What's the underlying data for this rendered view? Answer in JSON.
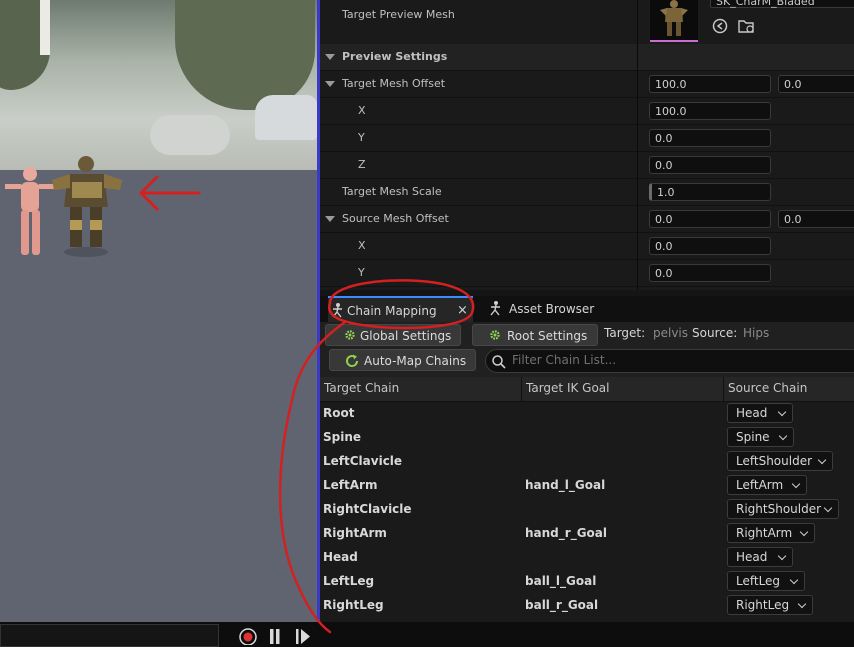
{
  "details": {
    "target_preview_mesh_label": "Target Preview Mesh",
    "mesh_name": "SK_CharM_Bladed",
    "preview_settings_label": "Preview Settings",
    "target_mesh_offset_label": "Target Mesh Offset",
    "target_mesh_offset_value": "100.0",
    "target_mesh_offset_value2": "0.0",
    "x_label": "X",
    "x_value": "100.0",
    "y_label": "Y",
    "y_value": "0.0",
    "z_label": "Z",
    "z_value": "0.0",
    "target_mesh_scale_label": "Target Mesh Scale",
    "target_mesh_scale_value": "1.0",
    "source_mesh_offset_label": "Source Mesh Offset",
    "source_mesh_offset_value": "0.0",
    "source_mesh_offset_value2": "0.0",
    "src_x_label": "X",
    "src_x_value": "0.0",
    "src_y_label": "Y",
    "src_y_value": "0.0"
  },
  "tabs": {
    "chain_mapping": "Chain Mapping",
    "close": "×",
    "asset_browser": "Asset Browser"
  },
  "toolbar": {
    "global_settings": "Global Settings",
    "root_settings": "Root Settings",
    "target_label": "Target:",
    "target_value": "pelvis",
    "source_label": "Source:",
    "source_value": "Hips",
    "auto_map": "Auto-Map Chains",
    "filter_placeholder": "Filter Chain List..."
  },
  "table": {
    "headers": [
      "Target Chain",
      "Target IK Goal",
      "Source Chain"
    ],
    "rows": [
      {
        "target": "Root",
        "goal": "",
        "source": "Head"
      },
      {
        "target": "Spine",
        "goal": "",
        "source": "Spine"
      },
      {
        "target": "LeftClavicle",
        "goal": "",
        "source": "LeftShoulder"
      },
      {
        "target": "LeftArm",
        "goal": "hand_l_Goal",
        "source": "LeftArm"
      },
      {
        "target": "RightClavicle",
        "goal": "",
        "source": "RightShoulder"
      },
      {
        "target": "RightArm",
        "goal": "hand_r_Goal",
        "source": "RightArm"
      },
      {
        "target": "Head",
        "goal": "",
        "source": "Head"
      },
      {
        "target": "LeftLeg",
        "goal": "ball_l_Goal",
        "source": "LeftLeg"
      },
      {
        "target": "RightLeg",
        "goal": "ball_r_Goal",
        "source": "RightLeg"
      }
    ]
  },
  "colors": {
    "annotation": "#d42020",
    "accent": "#3d8bff",
    "gear": "#8fd14f"
  }
}
